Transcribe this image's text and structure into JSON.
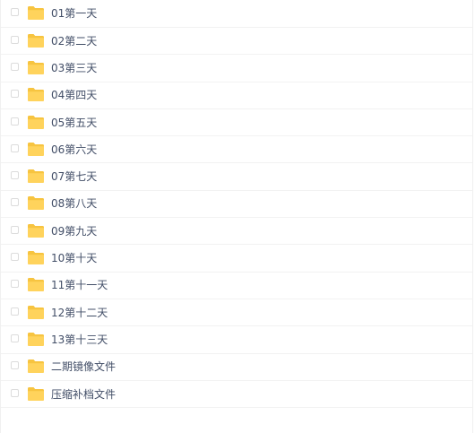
{
  "files": [
    {
      "name": "01第一天",
      "icon": "folder-icon"
    },
    {
      "name": "02第二天",
      "icon": "folder-icon"
    },
    {
      "name": "03第三天",
      "icon": "folder-icon"
    },
    {
      "name": "04第四天",
      "icon": "folder-icon"
    },
    {
      "name": "05第五天",
      "icon": "folder-icon"
    },
    {
      "name": "06第六天",
      "icon": "folder-icon"
    },
    {
      "name": "07第七天",
      "icon": "folder-icon"
    },
    {
      "name": "08第八天",
      "icon": "folder-icon"
    },
    {
      "name": "09第九天",
      "icon": "folder-icon"
    },
    {
      "name": "10第十天",
      "icon": "folder-icon"
    },
    {
      "name": "11第十一天",
      "icon": "folder-icon"
    },
    {
      "name": "12第十二天",
      "icon": "folder-icon"
    },
    {
      "name": "13第十三天",
      "icon": "folder-icon"
    },
    {
      "name": "二期镜像文件",
      "icon": "folder-icon"
    },
    {
      "name": "压缩补档文件",
      "icon": "folder-icon"
    }
  ],
  "colors": {
    "folder": "#ffd35c",
    "folder_tab": "#f7c440",
    "text": "#424e67",
    "divider": "#f2f2f2"
  }
}
